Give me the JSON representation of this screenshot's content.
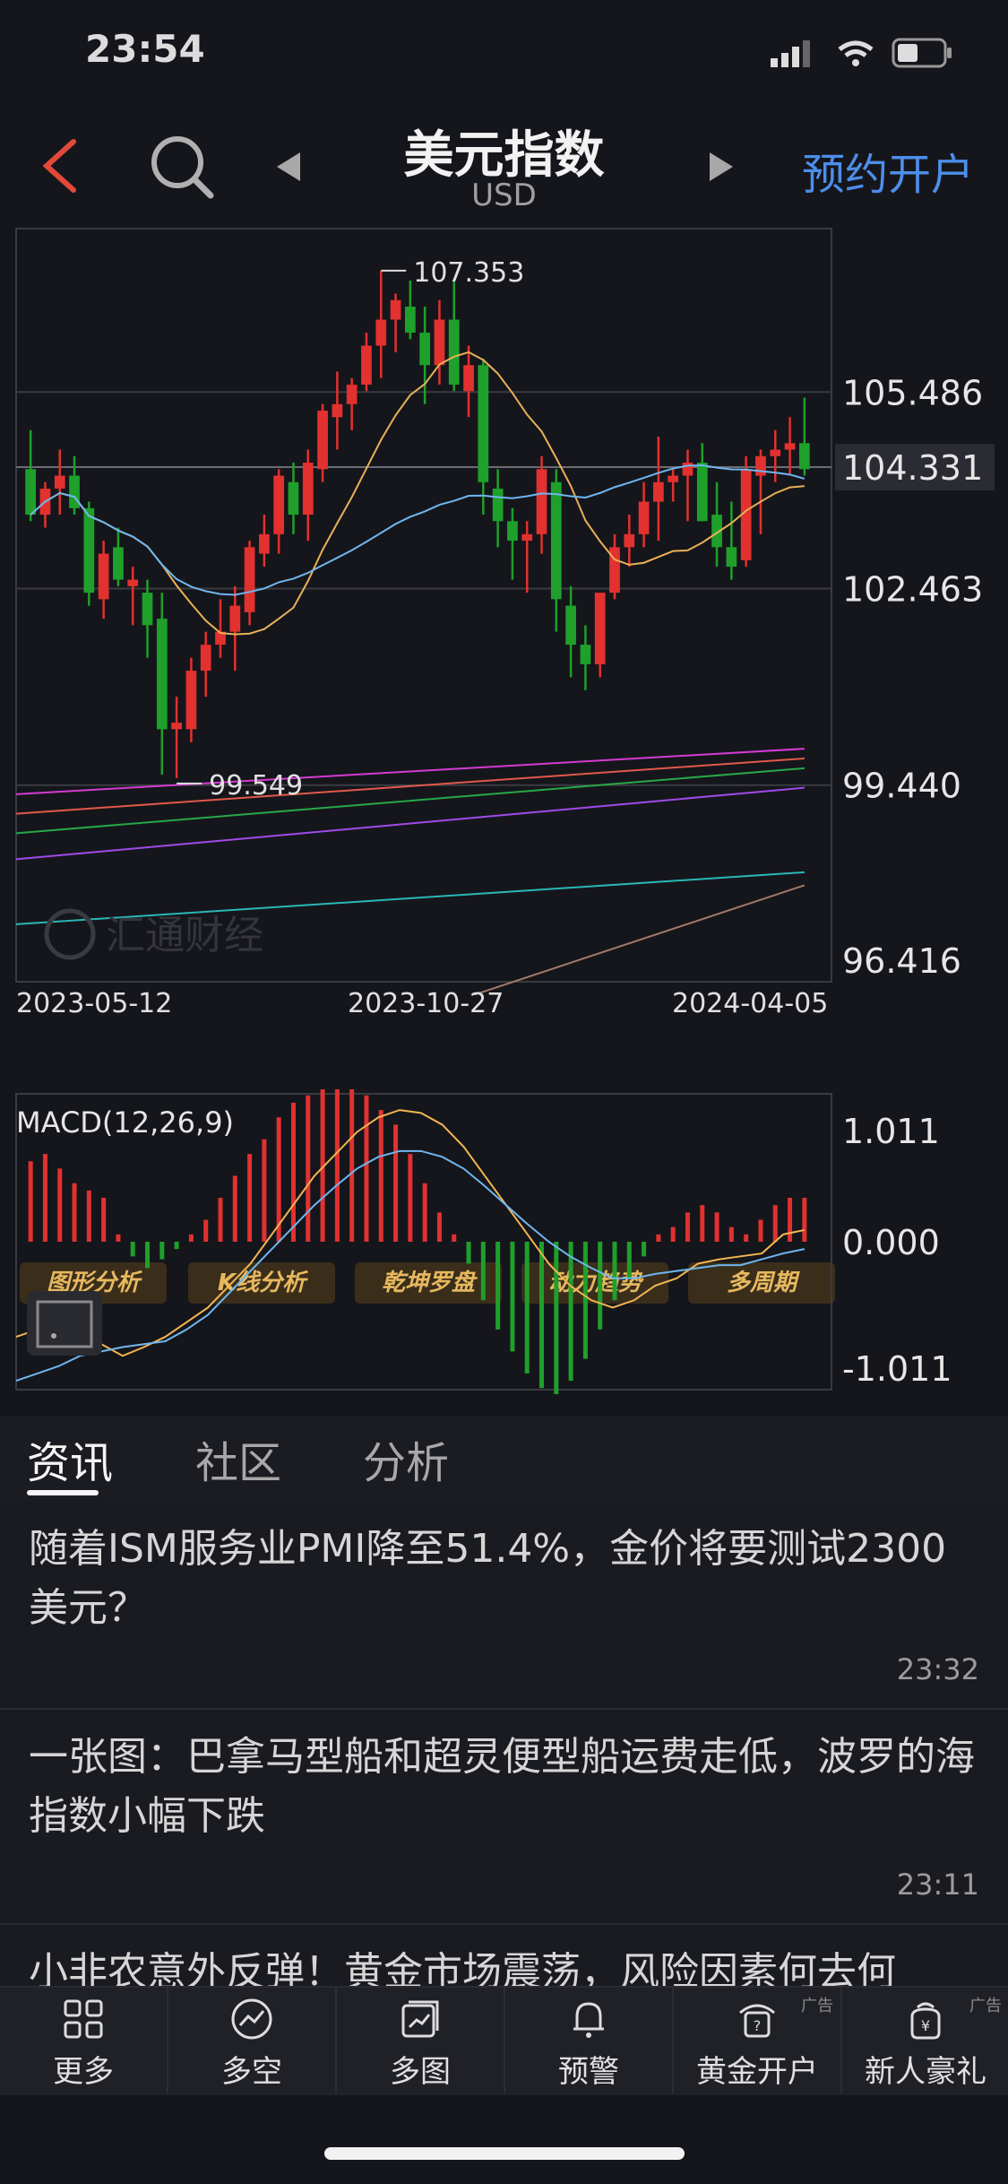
{
  "status_bar": {
    "time": "23:54"
  },
  "header": {
    "back_icon": "chevron-left-icon",
    "search_icon": "search-icon",
    "title": "美元指数",
    "subtitle": "USD",
    "reserve_label": "预约开户"
  },
  "chart_data": [
    {
      "type": "candlestick",
      "y_axis_labels": [
        "105.486",
        "104.331",
        "102.463",
        "99.440",
        "96.416"
      ],
      "current_price": "104.331",
      "high_label": "107.353",
      "low_label": "99.549",
      "x_axis_labels": [
        "2023-05-12",
        "2023-10-27",
        "2024-04-05"
      ],
      "watermark": "汇通财经",
      "ylim": [
        96.416,
        108.0
      ],
      "candles": [
        [
          104.3,
          104.9,
          103.5,
          103.6
        ],
        [
          103.6,
          104.1,
          103.4,
          104.0
        ],
        [
          104.0,
          104.6,
          103.6,
          104.2
        ],
        [
          104.2,
          104.5,
          103.6,
          103.7
        ],
        [
          103.7,
          103.8,
          102.2,
          102.4
        ],
        [
          102.3,
          103.2,
          102.0,
          103.0
        ],
        [
          103.1,
          103.4,
          102.5,
          102.6
        ],
        [
          102.5,
          102.8,
          101.9,
          102.6
        ],
        [
          102.4,
          102.6,
          101.4,
          101.9
        ],
        [
          102.0,
          102.4,
          99.6,
          100.3
        ],
        [
          100.3,
          100.8,
          99.549,
          100.4
        ],
        [
          100.3,
          101.4,
          100.1,
          101.2
        ],
        [
          101.2,
          101.8,
          100.8,
          101.6
        ],
        [
          101.6,
          102.3,
          101.4,
          101.8
        ],
        [
          101.8,
          102.5,
          101.2,
          102.2
        ],
        [
          102.1,
          103.2,
          101.9,
          103.1
        ],
        [
          103.0,
          103.6,
          102.8,
          103.3
        ],
        [
          103.3,
          104.3,
          103.0,
          104.2
        ],
        [
          104.1,
          104.4,
          103.3,
          103.6
        ],
        [
          103.6,
          104.6,
          103.2,
          104.4
        ],
        [
          104.3,
          105.3,
          104.1,
          105.2
        ],
        [
          105.1,
          105.8,
          104.6,
          105.3
        ],
        [
          105.3,
          105.7,
          104.9,
          105.6
        ],
        [
          105.6,
          106.4,
          105.5,
          106.2
        ],
        [
          106.2,
          107.353,
          105.7,
          106.6
        ],
        [
          106.6,
          107.0,
          106.1,
          106.9
        ],
        [
          106.8,
          107.2,
          106.3,
          106.4
        ],
        [
          106.4,
          106.8,
          105.3,
          105.9
        ],
        [
          105.9,
          106.9,
          105.6,
          106.6
        ],
        [
          106.6,
          107.2,
          105.5,
          105.6
        ],
        [
          105.5,
          106.2,
          105.1,
          105.9
        ],
        [
          105.9,
          106.0,
          103.6,
          104.1
        ],
        [
          104.0,
          104.3,
          103.1,
          103.5
        ],
        [
          103.5,
          103.7,
          102.6,
          103.2
        ],
        [
          103.2,
          103.5,
          102.4,
          103.3
        ],
        [
          103.3,
          104.5,
          103.0,
          104.3
        ],
        [
          104.1,
          104.3,
          101.8,
          102.3
        ],
        [
          102.2,
          102.5,
          101.1,
          101.6
        ],
        [
          101.6,
          101.9,
          100.9,
          101.3
        ],
        [
          101.3,
          102.3,
          101.1,
          102.4
        ],
        [
          102.4,
          103.3,
          102.3,
          103.1
        ],
        [
          103.1,
          103.6,
          102.8,
          103.3
        ],
        [
          103.3,
          104.1,
          103.1,
          103.8
        ],
        [
          103.8,
          104.8,
          103.2,
          104.1
        ],
        [
          104.1,
          104.3,
          103.8,
          104.2
        ],
        [
          104.2,
          104.6,
          103.5,
          104.4
        ],
        [
          104.4,
          104.7,
          103.5,
          103.5
        ],
        [
          103.6,
          104.1,
          102.8,
          103.1
        ],
        [
          103.1,
          103.8,
          102.6,
          102.8
        ],
        [
          102.9,
          104.5,
          102.8,
          104.3
        ],
        [
          104.2,
          104.6,
          103.3,
          104.5
        ],
        [
          104.5,
          104.9,
          104.1,
          104.6
        ],
        [
          104.6,
          105.1,
          104.2,
          104.7
        ],
        [
          104.7,
          105.4,
          104.2,
          104.3
        ]
      ]
    },
    {
      "type": "macd",
      "title": "MACD(12,26,9)",
      "y_axis_labels": [
        "1.011",
        "0.000",
        "-1.011"
      ],
      "ylim": [
        -1.011,
        1.011
      ],
      "histogram": [
        0.55,
        0.6,
        0.5,
        0.4,
        0.35,
        0.3,
        0.05,
        -0.1,
        -0.18,
        -0.12,
        -0.05,
        0.05,
        0.15,
        0.3,
        0.45,
        0.6,
        0.7,
        0.85,
        0.95,
        1.0,
        1.1,
        1.1,
        1.08,
        1.0,
        0.9,
        0.8,
        0.6,
        0.4,
        0.2,
        0.05,
        -0.15,
        -0.4,
        -0.6,
        -0.75,
        -0.9,
        -1.0,
        -1.1,
        -0.95,
        -0.8,
        -0.6,
        -0.4,
        -0.25,
        -0.1,
        0.05,
        0.1,
        0.2,
        0.25,
        0.2,
        0.1,
        0.05,
        0.15,
        0.25,
        0.3,
        0.3
      ],
      "diff": [
        -0.65,
        -0.6,
        -0.55,
        -0.6,
        -0.7,
        -0.78,
        -0.72,
        -0.65,
        -0.55,
        -0.45,
        -0.3,
        -0.15,
        0.05,
        0.25,
        0.45,
        0.6,
        0.75,
        0.85,
        0.9,
        0.88,
        0.8,
        0.65,
        0.45,
        0.25,
        0.05,
        -0.15,
        -0.3,
        -0.4,
        -0.45,
        -0.4,
        -0.3,
        -0.25,
        -0.15,
        -0.12,
        -0.1,
        -0.08,
        0.05,
        0.08
      ],
      "dea": [
        -0.95,
        -0.9,
        -0.85,
        -0.78,
        -0.75,
        -0.72,
        -0.7,
        -0.68,
        -0.6,
        -0.5,
        -0.35,
        -0.2,
        -0.05,
        0.1,
        0.25,
        0.38,
        0.5,
        0.58,
        0.62,
        0.62,
        0.58,
        0.5,
        0.38,
        0.25,
        0.12,
        0.0,
        -0.1,
        -0.18,
        -0.25,
        -0.25,
        -0.22,
        -0.2,
        -0.18,
        -0.16,
        -0.16,
        -0.12,
        -0.08,
        -0.05
      ]
    }
  ],
  "analysis_buttons": [
    "图形分析",
    "K线分析",
    "乾坤罗盘",
    "动力趋势",
    "多周期"
  ],
  "tabs": [
    {
      "label": "资讯",
      "active": true
    },
    {
      "label": "社区",
      "active": false
    },
    {
      "label": "分析",
      "active": false
    }
  ],
  "news": [
    {
      "title": "随着ISM服务业PMI降至51.4%，金价将要测试2300美元？",
      "time": "23:32"
    },
    {
      "title": "一张图：巴拿马型船和超灵便型船运费走低，波罗的海指数小幅下跌",
      "time": "23:11"
    },
    {
      "title": "小非农意外反弹！黄金市场震荡，风险因素何去何",
      "time": ""
    }
  ],
  "bottom_nav": [
    {
      "label": "更多",
      "icon": "grid-icon",
      "ad": ""
    },
    {
      "label": "多空",
      "icon": "trend-icon",
      "ad": ""
    },
    {
      "label": "多图",
      "icon": "multi-chart-icon",
      "ad": ""
    },
    {
      "label": "预警",
      "icon": "bell-icon",
      "ad": ""
    },
    {
      "label": "黄金开户",
      "icon": "gold-account-icon",
      "ad": "广告"
    },
    {
      "label": "新人豪礼",
      "icon": "gift-bag-icon",
      "ad": "广告"
    }
  ],
  "colors": {
    "up": "#e2312f",
    "down": "#1ea02a",
    "accent": "#4d8eea",
    "macd_diff": "#f2b552",
    "macd_dea": "#6fb6ef"
  }
}
